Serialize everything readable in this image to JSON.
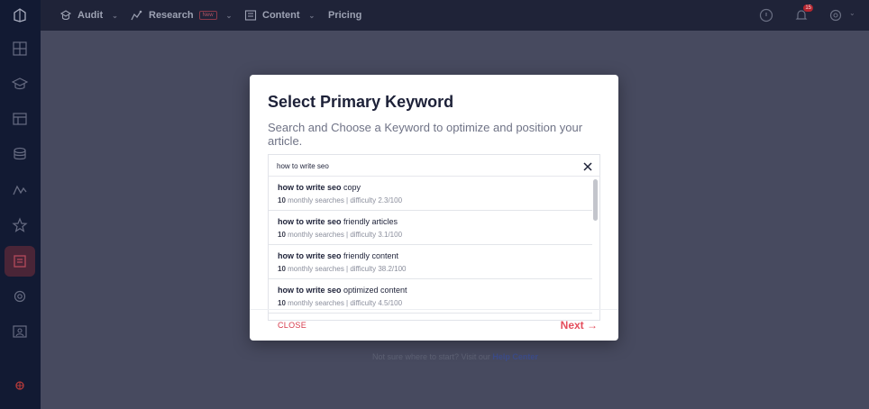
{
  "topbar": {
    "nav": [
      {
        "label": "Audit",
        "icon": "audit-icon"
      },
      {
        "label": "Research",
        "icon": "research-icon",
        "badge": "New"
      },
      {
        "label": "Content",
        "icon": "content-icon"
      },
      {
        "label": "Pricing"
      }
    ],
    "notification_count": "15"
  },
  "modal": {
    "title": "Select Primary Keyword",
    "subtitle": "Search and Choose a Keyword to optimize and position your article.",
    "search": {
      "value": "how to write seo"
    },
    "suggestions": [
      {
        "bold": "how to write seo",
        "rest": " copy",
        "count": "10",
        "meta": " monthly searches | difficulty 2.3/100"
      },
      {
        "bold": "how to write seo",
        "rest": " friendly articles",
        "count": "10",
        "meta": " monthly searches | difficulty 3.1/100"
      },
      {
        "bold": "how to write seo",
        "rest": " friendly content",
        "count": "10",
        "meta": " monthly searches | difficulty 38.2/100"
      },
      {
        "bold": "how to write seo",
        "rest": " optimized content",
        "count": "10",
        "meta": " monthly searches | difficulty 4.5/100"
      }
    ],
    "close_label": "CLOSE",
    "next_label": "Next →"
  },
  "background": {
    "help_text": "Not sure where to start? Visit our ",
    "help_link": "Help Center"
  },
  "colors": {
    "accent": "#e44d5c",
    "sidebar": "#121a33",
    "topbar": "#1f2338"
  }
}
